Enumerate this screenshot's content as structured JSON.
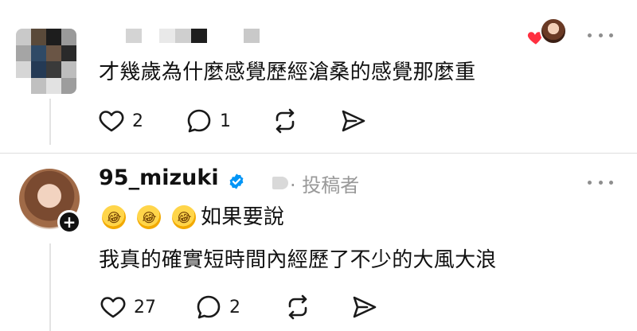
{
  "comments": [
    {
      "text": "才幾歲為什麼感覺歷經滄桑的感覺那麼重",
      "likes": "2",
      "replies": "1"
    },
    {
      "username": "95_mizuki",
      "role": "· 投稿者",
      "emojis": [
        "rolling-on-floor-laughing",
        "rolling-on-floor-laughing",
        "rolling-on-floor-laughing"
      ],
      "text_line1": "如果要說",
      "text_line2": "我真的確實短時間內經歷了不少的大風大浪",
      "likes": "27",
      "replies": "2"
    }
  ],
  "colors": {
    "text": "#111111",
    "muted": "#999999",
    "verified": "#0095f6",
    "heart": "#ff3040",
    "divider": "#dedede"
  },
  "icons": [
    "heart-icon",
    "comment-icon",
    "repost-icon",
    "share-icon",
    "more-icon",
    "verified-icon",
    "plus-icon"
  ]
}
